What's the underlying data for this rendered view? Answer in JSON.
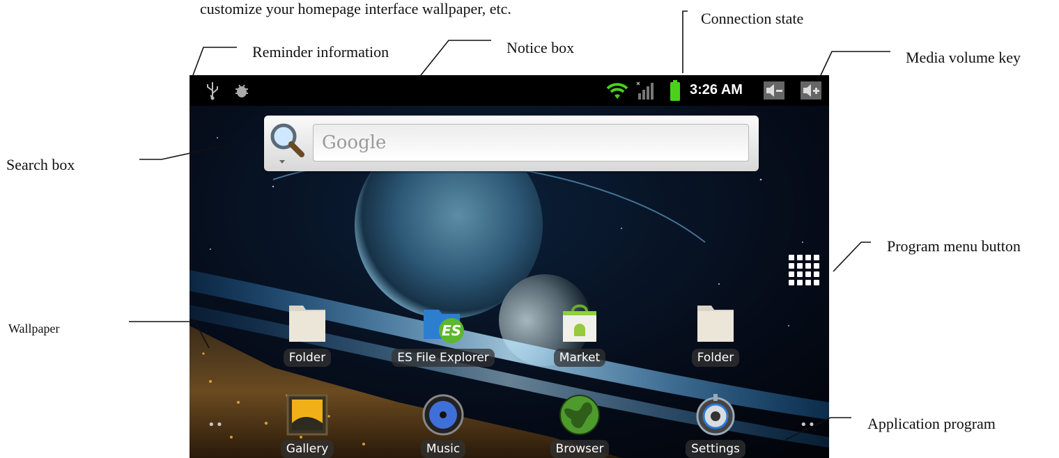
{
  "annotations": {
    "intro_text": "customize your homepage interface wallpaper, etc.",
    "reminder": "Reminder information",
    "notice": "Notice box",
    "connection": "Connection state",
    "media_volume": "Media volume key",
    "search_box": "Search box",
    "program_menu": "Program menu button",
    "wallpaper": "Wallpaper",
    "application": "Application program"
  },
  "status_bar": {
    "time": "3:26 AM",
    "icons": [
      "usb-icon",
      "debug-icon",
      "wifi-icon",
      "signal-icon",
      "battery-icon",
      "volume-down-icon",
      "volume-up-icon"
    ],
    "battery_color": "#4ad11a"
  },
  "search": {
    "placeholder": "Google"
  },
  "home": {
    "app_menu_icon": "grid-icon",
    "row1": [
      {
        "label": "Folder",
        "icon": "folder-icon"
      },
      {
        "label": "ES File Explorer",
        "icon": "es-file-explorer-icon"
      },
      {
        "label": "Market",
        "icon": "market-icon"
      },
      {
        "label": "Folder",
        "icon": "folder-icon"
      }
    ],
    "dock": [
      {
        "label": "Gallery",
        "icon": "gallery-icon"
      },
      {
        "label": "Music",
        "icon": "music-icon"
      },
      {
        "label": "Browser",
        "icon": "browser-icon"
      },
      {
        "label": "Settings",
        "icon": "settings-icon"
      }
    ]
  }
}
